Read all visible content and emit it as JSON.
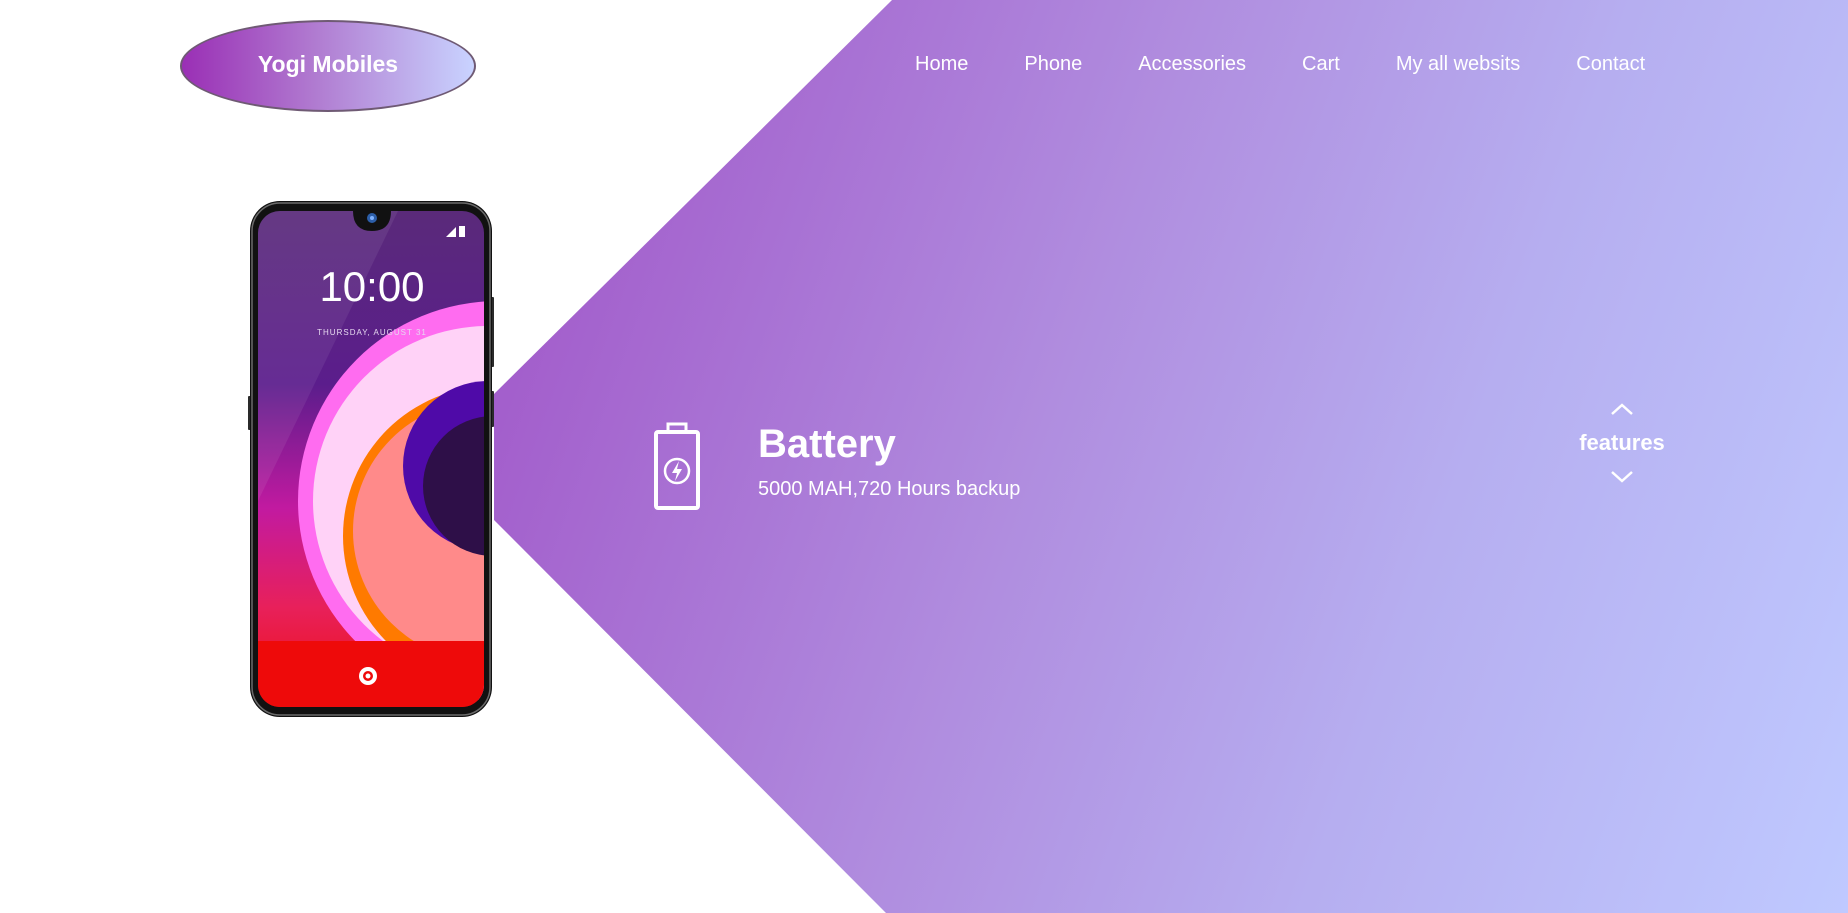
{
  "brand": {
    "name": "Yogi Mobiles"
  },
  "nav": {
    "items": [
      {
        "label": "Home"
      },
      {
        "label": "Phone"
      },
      {
        "label": "Accessories"
      },
      {
        "label": "Cart"
      },
      {
        "label": "My all websits"
      },
      {
        "label": "Contact"
      }
    ]
  },
  "phone_screen": {
    "time": "10:00",
    "date": "THURSDAY, AUGUST 31"
  },
  "feature": {
    "icon": "battery-icon",
    "title": "Battery",
    "description": "5000 MAH,720 Hours backup"
  },
  "features_nav": {
    "label": "features",
    "up_icon": "chevron-up-icon",
    "down_icon": "chevron-down-icon"
  },
  "colors": {
    "gradient_start": "#a259c8",
    "gradient_end": "#bfc9ff",
    "text": "#ffffff"
  }
}
